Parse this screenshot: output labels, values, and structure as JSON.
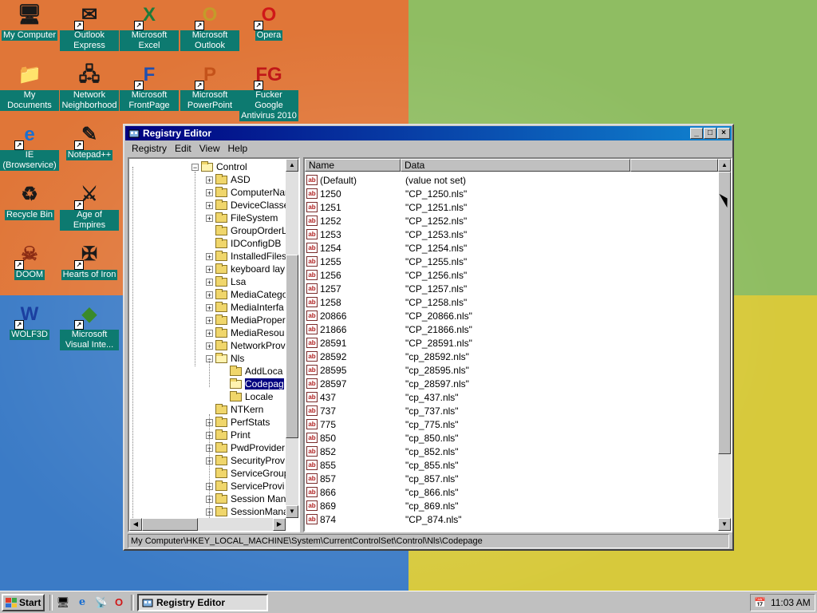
{
  "desktop": {
    "icons": [
      {
        "label": "My Computer",
        "icon": "computer-icon"
      },
      {
        "label": "Outlook Express",
        "icon": "outlook-express-icon"
      },
      {
        "label": "Microsoft Excel",
        "icon": "excel-icon"
      },
      {
        "label": "Microsoft Outlook",
        "icon": "outlook-icon"
      },
      {
        "label": "Opera",
        "icon": "opera-icon"
      },
      {
        "label": "My Documents",
        "icon": "documents-folder-icon"
      },
      {
        "label": "Network Neighborhood",
        "icon": "network-icon"
      },
      {
        "label": "Microsoft FrontPage",
        "icon": "frontpage-icon"
      },
      {
        "label": "Microsoft PowerPoint",
        "icon": "powerpoint-icon"
      },
      {
        "label": "Fucker Google Antivirus 2010",
        "icon": "antivirus-icon"
      },
      {
        "label": "IE (Browservice)",
        "icon": "ie-icon"
      },
      {
        "label": "Notepad++",
        "icon": "notepad-icon"
      },
      {
        "label": "Recycle Bin",
        "icon": "recycle-bin-icon"
      },
      {
        "label": "Age of Empires",
        "icon": "age-of-empires-icon"
      },
      {
        "label": "DOOM",
        "icon": "doom-icon"
      },
      {
        "label": "Hearts of Iron",
        "icon": "hearts-of-iron-icon"
      },
      {
        "label": "WOLF3D",
        "icon": "wolf3d-icon"
      },
      {
        "label": "Microsoft Visual Inte...",
        "icon": "visual-interdev-icon"
      }
    ]
  },
  "window": {
    "title": "Registry Editor",
    "controls": {
      "minimize": "_",
      "maximize": "□",
      "close": "×"
    },
    "menu": [
      "Registry",
      "Edit",
      "View",
      "Help"
    ],
    "tree": [
      {
        "label": "Control",
        "level": 0,
        "toggle": "−",
        "open": true
      },
      {
        "label": "ASD",
        "level": 1,
        "toggle": "+"
      },
      {
        "label": "ComputerNar",
        "level": 1,
        "toggle": "+"
      },
      {
        "label": "DeviceClasse",
        "level": 1,
        "toggle": "+"
      },
      {
        "label": "FileSystem",
        "level": 1,
        "toggle": "+"
      },
      {
        "label": "GroupOrderL",
        "level": 1,
        "toggle": ""
      },
      {
        "label": "IDConfigDB",
        "level": 1,
        "toggle": ""
      },
      {
        "label": "InstalledFiles",
        "level": 1,
        "toggle": "+"
      },
      {
        "label": "keyboard lay",
        "level": 1,
        "toggle": "+"
      },
      {
        "label": "Lsa",
        "level": 1,
        "toggle": "+"
      },
      {
        "label": "MediaCatego",
        "level": 1,
        "toggle": "+"
      },
      {
        "label": "MediaInterfa",
        "level": 1,
        "toggle": "+"
      },
      {
        "label": "MediaProper",
        "level": 1,
        "toggle": "+"
      },
      {
        "label": "MediaResou",
        "level": 1,
        "toggle": "+"
      },
      {
        "label": "NetworkProv",
        "level": 1,
        "toggle": "+"
      },
      {
        "label": "Nls",
        "level": 1,
        "toggle": "−",
        "open": true
      },
      {
        "label": "AddLoca",
        "level": 2,
        "toggle": ""
      },
      {
        "label": "Codepag",
        "level": 2,
        "toggle": "",
        "selected": true,
        "open": true
      },
      {
        "label": "Locale",
        "level": 2,
        "toggle": ""
      },
      {
        "label": "NTKern",
        "level": 1,
        "toggle": ""
      },
      {
        "label": "PerfStats",
        "level": 1,
        "toggle": "+"
      },
      {
        "label": "Print",
        "level": 1,
        "toggle": "+"
      },
      {
        "label": "PwdProvider",
        "level": 1,
        "toggle": "+"
      },
      {
        "label": "SecurityProv",
        "level": 1,
        "toggle": "+"
      },
      {
        "label": "ServiceGroup",
        "level": 1,
        "toggle": ""
      },
      {
        "label": "ServiceProvi",
        "level": 1,
        "toggle": "+"
      },
      {
        "label": "Session Man",
        "level": 1,
        "toggle": "+"
      },
      {
        "label": "SessionMana",
        "level": 1,
        "toggle": "+"
      }
    ],
    "columns": {
      "name": "Name",
      "data": "Data"
    },
    "values": [
      {
        "name": "(Default)",
        "data": "(value not set)"
      },
      {
        "name": "1250",
        "data": "\"CP_1250.nls\""
      },
      {
        "name": "1251",
        "data": "\"CP_1251.nls\""
      },
      {
        "name": "1252",
        "data": "\"CP_1252.nls\""
      },
      {
        "name": "1253",
        "data": "\"CP_1253.nls\""
      },
      {
        "name": "1254",
        "data": "\"CP_1254.nls\""
      },
      {
        "name": "1255",
        "data": "\"CP_1255.nls\""
      },
      {
        "name": "1256",
        "data": "\"CP_1256.nls\""
      },
      {
        "name": "1257",
        "data": "\"CP_1257.nls\""
      },
      {
        "name": "1258",
        "data": "\"CP_1258.nls\""
      },
      {
        "name": "20866",
        "data": "\"CP_20866.nls\""
      },
      {
        "name": "21866",
        "data": "\"CP_21866.nls\""
      },
      {
        "name": "28591",
        "data": "\"CP_28591.nls\""
      },
      {
        "name": "28592",
        "data": "\"cp_28592.nls\""
      },
      {
        "name": "28595",
        "data": "\"cp_28595.nls\""
      },
      {
        "name": "28597",
        "data": "\"cp_28597.nls\""
      },
      {
        "name": "437",
        "data": "\"cp_437.nls\""
      },
      {
        "name": "737",
        "data": "\"cp_737.nls\""
      },
      {
        "name": "775",
        "data": "\"cp_775.nls\""
      },
      {
        "name": "850",
        "data": "\"cp_850.nls\""
      },
      {
        "name": "852",
        "data": "\"cp_852.nls\""
      },
      {
        "name": "855",
        "data": "\"cp_855.nls\""
      },
      {
        "name": "857",
        "data": "\"cp_857.nls\""
      },
      {
        "name": "866",
        "data": "\"cp_866.nls\""
      },
      {
        "name": "869",
        "data": "\"cp_869.nls\""
      },
      {
        "name": "874",
        "data": "\"CP_874.nls\""
      }
    ],
    "status": "My Computer\\HKEY_LOCAL_MACHINE\\System\\CurrentControlSet\\Control\\Nls\\Codepage"
  },
  "taskbar": {
    "start_label": "Start",
    "quick_launch": [
      "desktop-icon",
      "ie-icon",
      "channels-icon",
      "opera-icon"
    ],
    "task_label": "Registry Editor",
    "clock": "11:03 AM"
  },
  "colors": {
    "titlebar_start": "#000080",
    "titlebar_end": "#1084d0",
    "icon_label_bg": "#0d7a70",
    "face": "#c0c0c0"
  }
}
